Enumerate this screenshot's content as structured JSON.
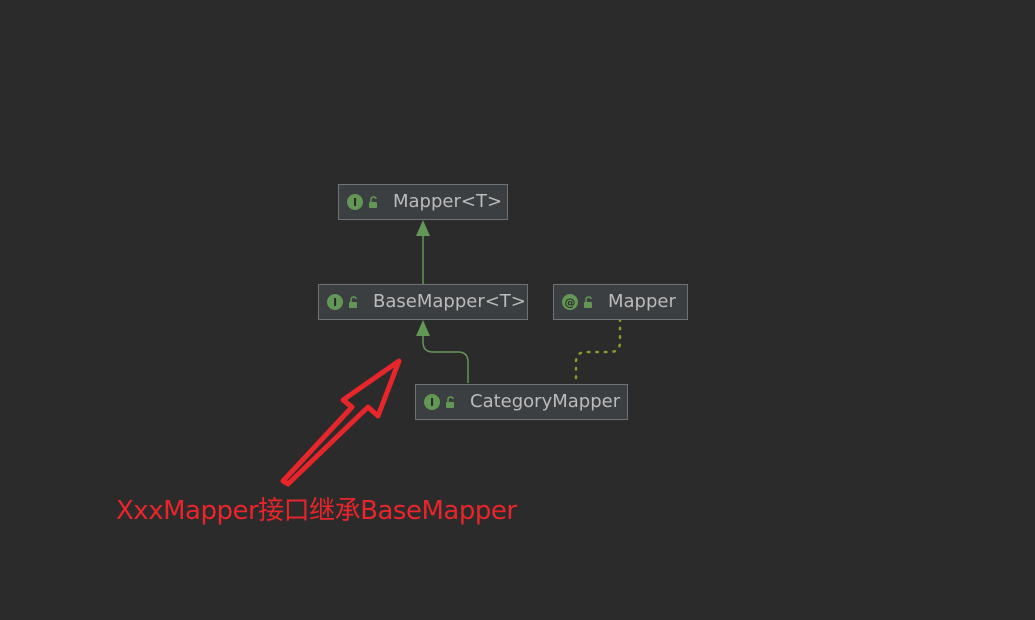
{
  "diagram": {
    "background": "#2b2b2b",
    "nodes": {
      "mapper_generic": {
        "label": "Mapper<T>",
        "kind": "interface",
        "kind_glyph": "I",
        "icon": "interface-icon"
      },
      "base_mapper": {
        "label": "BaseMapper<T>",
        "kind": "interface",
        "kind_glyph": "I",
        "icon": "interface-icon"
      },
      "mapper_annotation": {
        "label": "Mapper",
        "kind": "annotation",
        "kind_glyph": "@",
        "icon": "annotation-icon"
      },
      "category_mapper": {
        "label": "CategoryMapper",
        "kind": "interface",
        "kind_glyph": "I",
        "icon": "interface-icon"
      }
    },
    "edges": [
      {
        "from": "base_mapper",
        "to": "mapper_generic",
        "type": "extends",
        "style": "solid",
        "color": "#629755"
      },
      {
        "from": "category_mapper",
        "to": "base_mapper",
        "type": "extends",
        "style": "solid",
        "color": "#629755"
      },
      {
        "from": "category_mapper",
        "to": "mapper_annotation",
        "type": "annotated-by",
        "style": "dotted",
        "color": "#8a9a2b"
      }
    ],
    "colors": {
      "node_fill": "#3c3f41",
      "node_border": "#6f7376",
      "node_text": "#bbbbbb",
      "icon_green": "#629755",
      "annotation_red": "#e8252b"
    }
  },
  "annotation": {
    "text": "XxxMapper接口继承BaseMapper",
    "color": "#e8252b"
  }
}
